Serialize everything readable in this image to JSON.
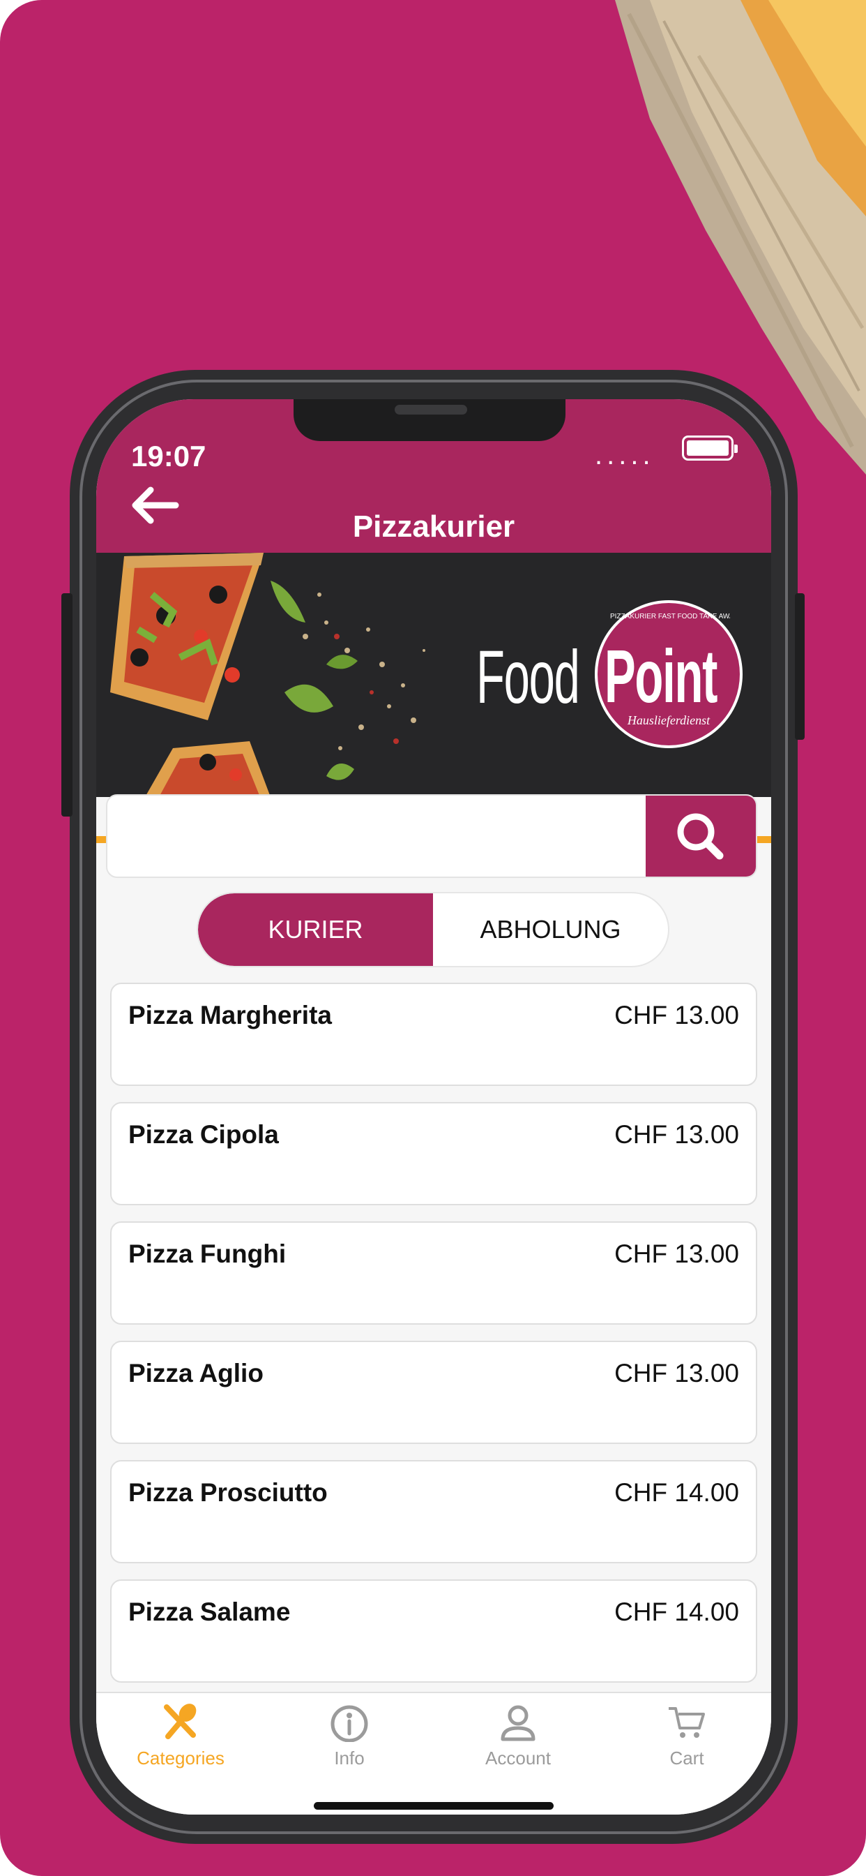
{
  "status_bar": {
    "time": "19:07",
    "signal": "....."
  },
  "header": {
    "title": "Pizzakurier"
  },
  "banner": {
    "brand_left": "Food",
    "brand_right": "Point",
    "badge_arc": "PIZZAKURIER FAST FOOD TAKE AWAY",
    "badge_sub": "Hauslieferdienst"
  },
  "search": {
    "placeholder": "",
    "value": ""
  },
  "mode_toggle": {
    "active": "KURIER",
    "inactive": "ABHOLUNG"
  },
  "menu_items": [
    {
      "name": "Pizza Margherita",
      "price": "CHF 13.00"
    },
    {
      "name": "Pizza Cipola",
      "price": "CHF 13.00"
    },
    {
      "name": "Pizza Funghi",
      "price": "CHF 13.00"
    },
    {
      "name": "Pizza Aglio",
      "price": "CHF 13.00"
    },
    {
      "name": "Pizza Prosciutto",
      "price": "CHF 14.00"
    },
    {
      "name": "Pizza Salame",
      "price": "CHF 14.00"
    }
  ],
  "tabbar": {
    "categories": "Categories",
    "info": "Info",
    "account": "Account",
    "cart": "Cart"
  },
  "colors": {
    "brand": "#a9265e",
    "background": "#bb2369",
    "accent": "#f5a623"
  }
}
